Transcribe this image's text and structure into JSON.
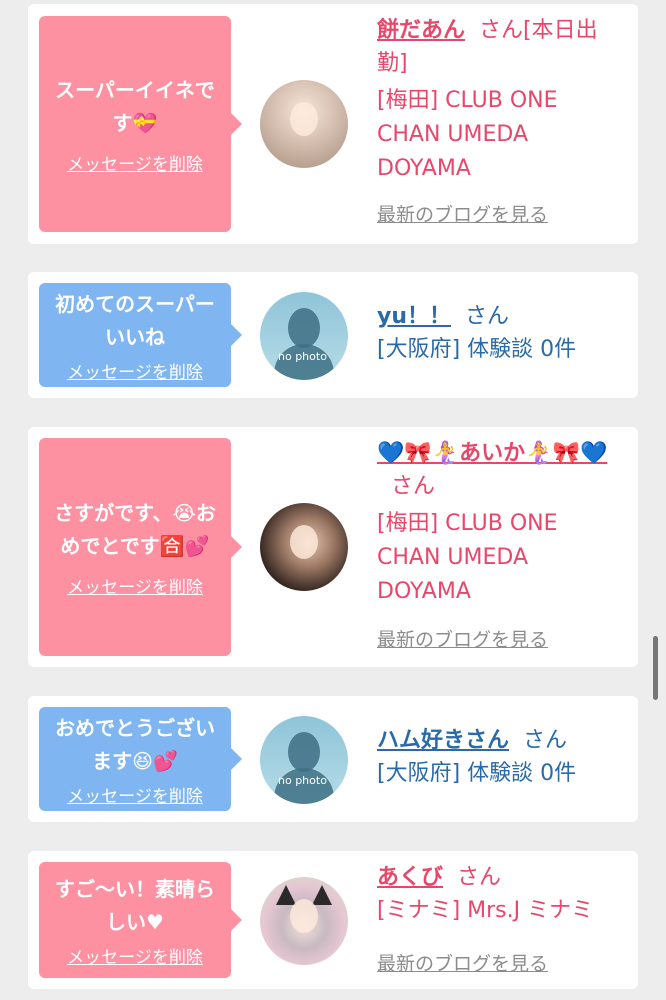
{
  "items": [
    {
      "message": "スーパーイイネです💝",
      "delete_label": "メッセージを削除",
      "avatar": "photo",
      "name": "餅だあん",
      "suffix": "さん[本日出勤]",
      "shop": "[梅田] CLUB ONE CHAN UMEDA DOYAMA",
      "blog": "最新のブログを見る",
      "colors": {
        "bubble": "#fd91a2",
        "text": "#e8476a"
      }
    },
    {
      "message": "初めてのスーパーいいね",
      "delete_label": "メッセージを削除",
      "avatar": "no photo",
      "name": "yu！！",
      "suffix": "さん",
      "shop": "[大阪府] 体験談 0件",
      "colors": {
        "bubble": "#7fb5f0",
        "text": "#2a6aa8"
      }
    },
    {
      "message": "さすがです、😭おめでとです🈴💕",
      "delete_label": "メッセージを削除",
      "avatar": "photo",
      "name": "💙🎀🧜‍♀️あいか🧜‍♀️🎀💙",
      "suffix": "さん",
      "shop": "[梅田] CLUB ONE CHAN UMEDA DOYAMA",
      "blog": "最新のブログを見る",
      "colors": {
        "bubble": "#fd91a2",
        "text": "#e8476a"
      }
    },
    {
      "message": "おめでとうございます😆💕",
      "delete_label": "メッセージを削除",
      "avatar": "no photo",
      "name": "ハム好きさん",
      "suffix": "さん",
      "shop": "[大阪府] 体験談 0件",
      "colors": {
        "bubble": "#7fb5f0",
        "text": "#2a6aa8"
      }
    },
    {
      "message": "すご〜い！素晴らしい♥",
      "delete_label": "メッセージを削除",
      "avatar": "photo",
      "name": "あくび",
      "suffix": "さん",
      "shop": "[ミナミ] Mrs.J ミナミ",
      "blog": "最新のブログを見る",
      "colors": {
        "bubble": "#fd91a2",
        "text": "#e8476a"
      }
    }
  ],
  "no_photo_label": "no photo"
}
